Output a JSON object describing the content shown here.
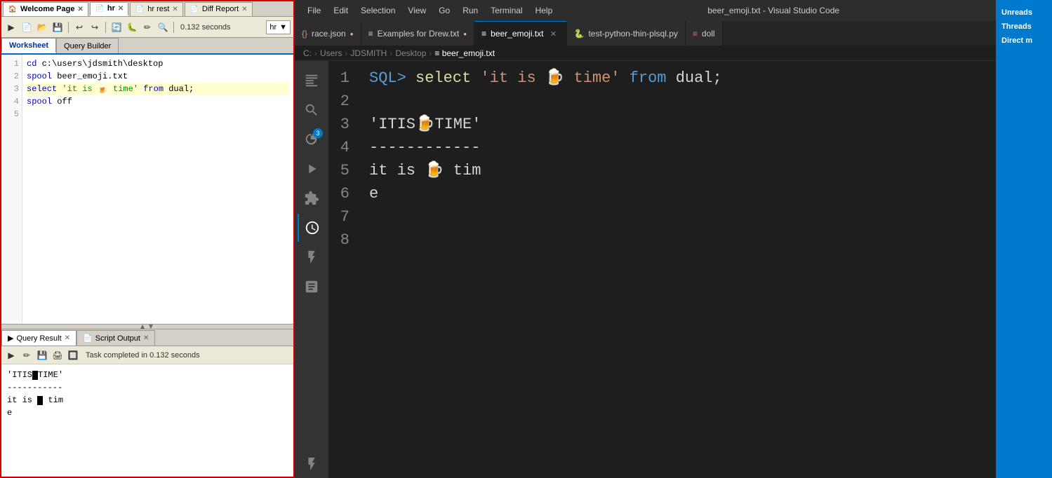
{
  "sqldeveloper": {
    "tabs": [
      {
        "label": "Welcome Page",
        "icon": "🏠",
        "active": false,
        "closable": true
      },
      {
        "label": "hr",
        "icon": "📄",
        "active": true,
        "closable": true
      },
      {
        "label": "hr rest",
        "icon": "📄",
        "active": false,
        "closable": true
      },
      {
        "label": "Diff Report",
        "icon": "📄",
        "active": false,
        "closable": true
      }
    ],
    "toolbar": {
      "time_label": "0.132 seconds",
      "connection": "hr"
    },
    "sub_tabs": [
      {
        "label": "Worksheet",
        "active": true
      },
      {
        "label": "Query Builder",
        "active": false
      }
    ],
    "code_lines": [
      {
        "num": 1,
        "text": "cd c:\\users\\jdsmith\\desktop",
        "type": "normal"
      },
      {
        "num": 2,
        "text": "spool beer_emoji.txt",
        "type": "normal"
      },
      {
        "num": 3,
        "text": "select 'it is 🍺 time' from dual;",
        "type": "highlighted"
      },
      {
        "num": 4,
        "text": "spool off",
        "type": "normal"
      },
      {
        "num": 5,
        "text": "",
        "type": "normal"
      }
    ],
    "bottom_tabs": [
      {
        "label": "Query Result",
        "active": true,
        "closable": true,
        "icon": "▶"
      },
      {
        "label": "Script Output",
        "active": false,
        "closable": true,
        "icon": "📄"
      }
    ],
    "bottom_toolbar": {
      "status": "Task completed in 0.132 seconds"
    },
    "result_lines": [
      "'ITIS🍺TIME'",
      "-----------",
      "it is 🍺 tim",
      "e"
    ]
  },
  "vscode": {
    "titlebar": {
      "title": "beer_emoji.txt - Visual Studio Code",
      "menu_items": [
        "File",
        "Edit",
        "Selection",
        "View",
        "Go",
        "Run",
        "Terminal",
        "Help"
      ]
    },
    "tabs": [
      {
        "label": "race.json",
        "icon": "{}",
        "active": false,
        "dot": true
      },
      {
        "label": "Examples for Drew.txt",
        "icon": "≡",
        "active": false,
        "dot": true
      },
      {
        "label": "beer_emoji.txt",
        "icon": "≡",
        "active": true,
        "dot": false,
        "closable": true
      },
      {
        "label": "test-python-thin-plsql.py",
        "icon": "🐍",
        "active": false,
        "dot": false
      },
      {
        "label": "doll",
        "icon": "≡",
        "active": false,
        "dot": false
      }
    ],
    "breadcrumb": {
      "parts": [
        "C:",
        "Users",
        "JDSMITH",
        "Desktop",
        "beer_emoji.txt"
      ]
    },
    "activity_bar": [
      {
        "icon": "⊞",
        "name": "explorer",
        "active": false
      },
      {
        "icon": "🔍",
        "name": "search",
        "active": false
      },
      {
        "icon": "⎇",
        "name": "source-control",
        "active": false
      },
      {
        "icon": "▷",
        "name": "run",
        "active": false
      },
      {
        "icon": "⊞",
        "name": "extensions",
        "active": false
      },
      {
        "icon": "🕐",
        "name": "timeline",
        "active": true
      },
      {
        "icon": "⚗",
        "name": "test",
        "active": false
      },
      {
        "icon": "📋",
        "name": "remote",
        "active": false
      },
      {
        "icon": "⚡",
        "name": "bottom",
        "active": false
      }
    ],
    "code_lines": [
      {
        "num": 1,
        "content": "SQL> select 'it is 🍺 time' from dual;"
      },
      {
        "num": 2,
        "content": ""
      },
      {
        "num": 3,
        "content": "'ITIS🍺TIME'"
      },
      {
        "num": 4,
        "content": "------------"
      },
      {
        "num": 5,
        "content": "it is 🍺 tim"
      },
      {
        "num": 6,
        "content": "e"
      },
      {
        "num": 7,
        "content": ""
      },
      {
        "num": 8,
        "content": ""
      }
    ]
  },
  "right_sidebar": {
    "items": [
      "Unreads",
      "Threads",
      "Direct m"
    ]
  }
}
